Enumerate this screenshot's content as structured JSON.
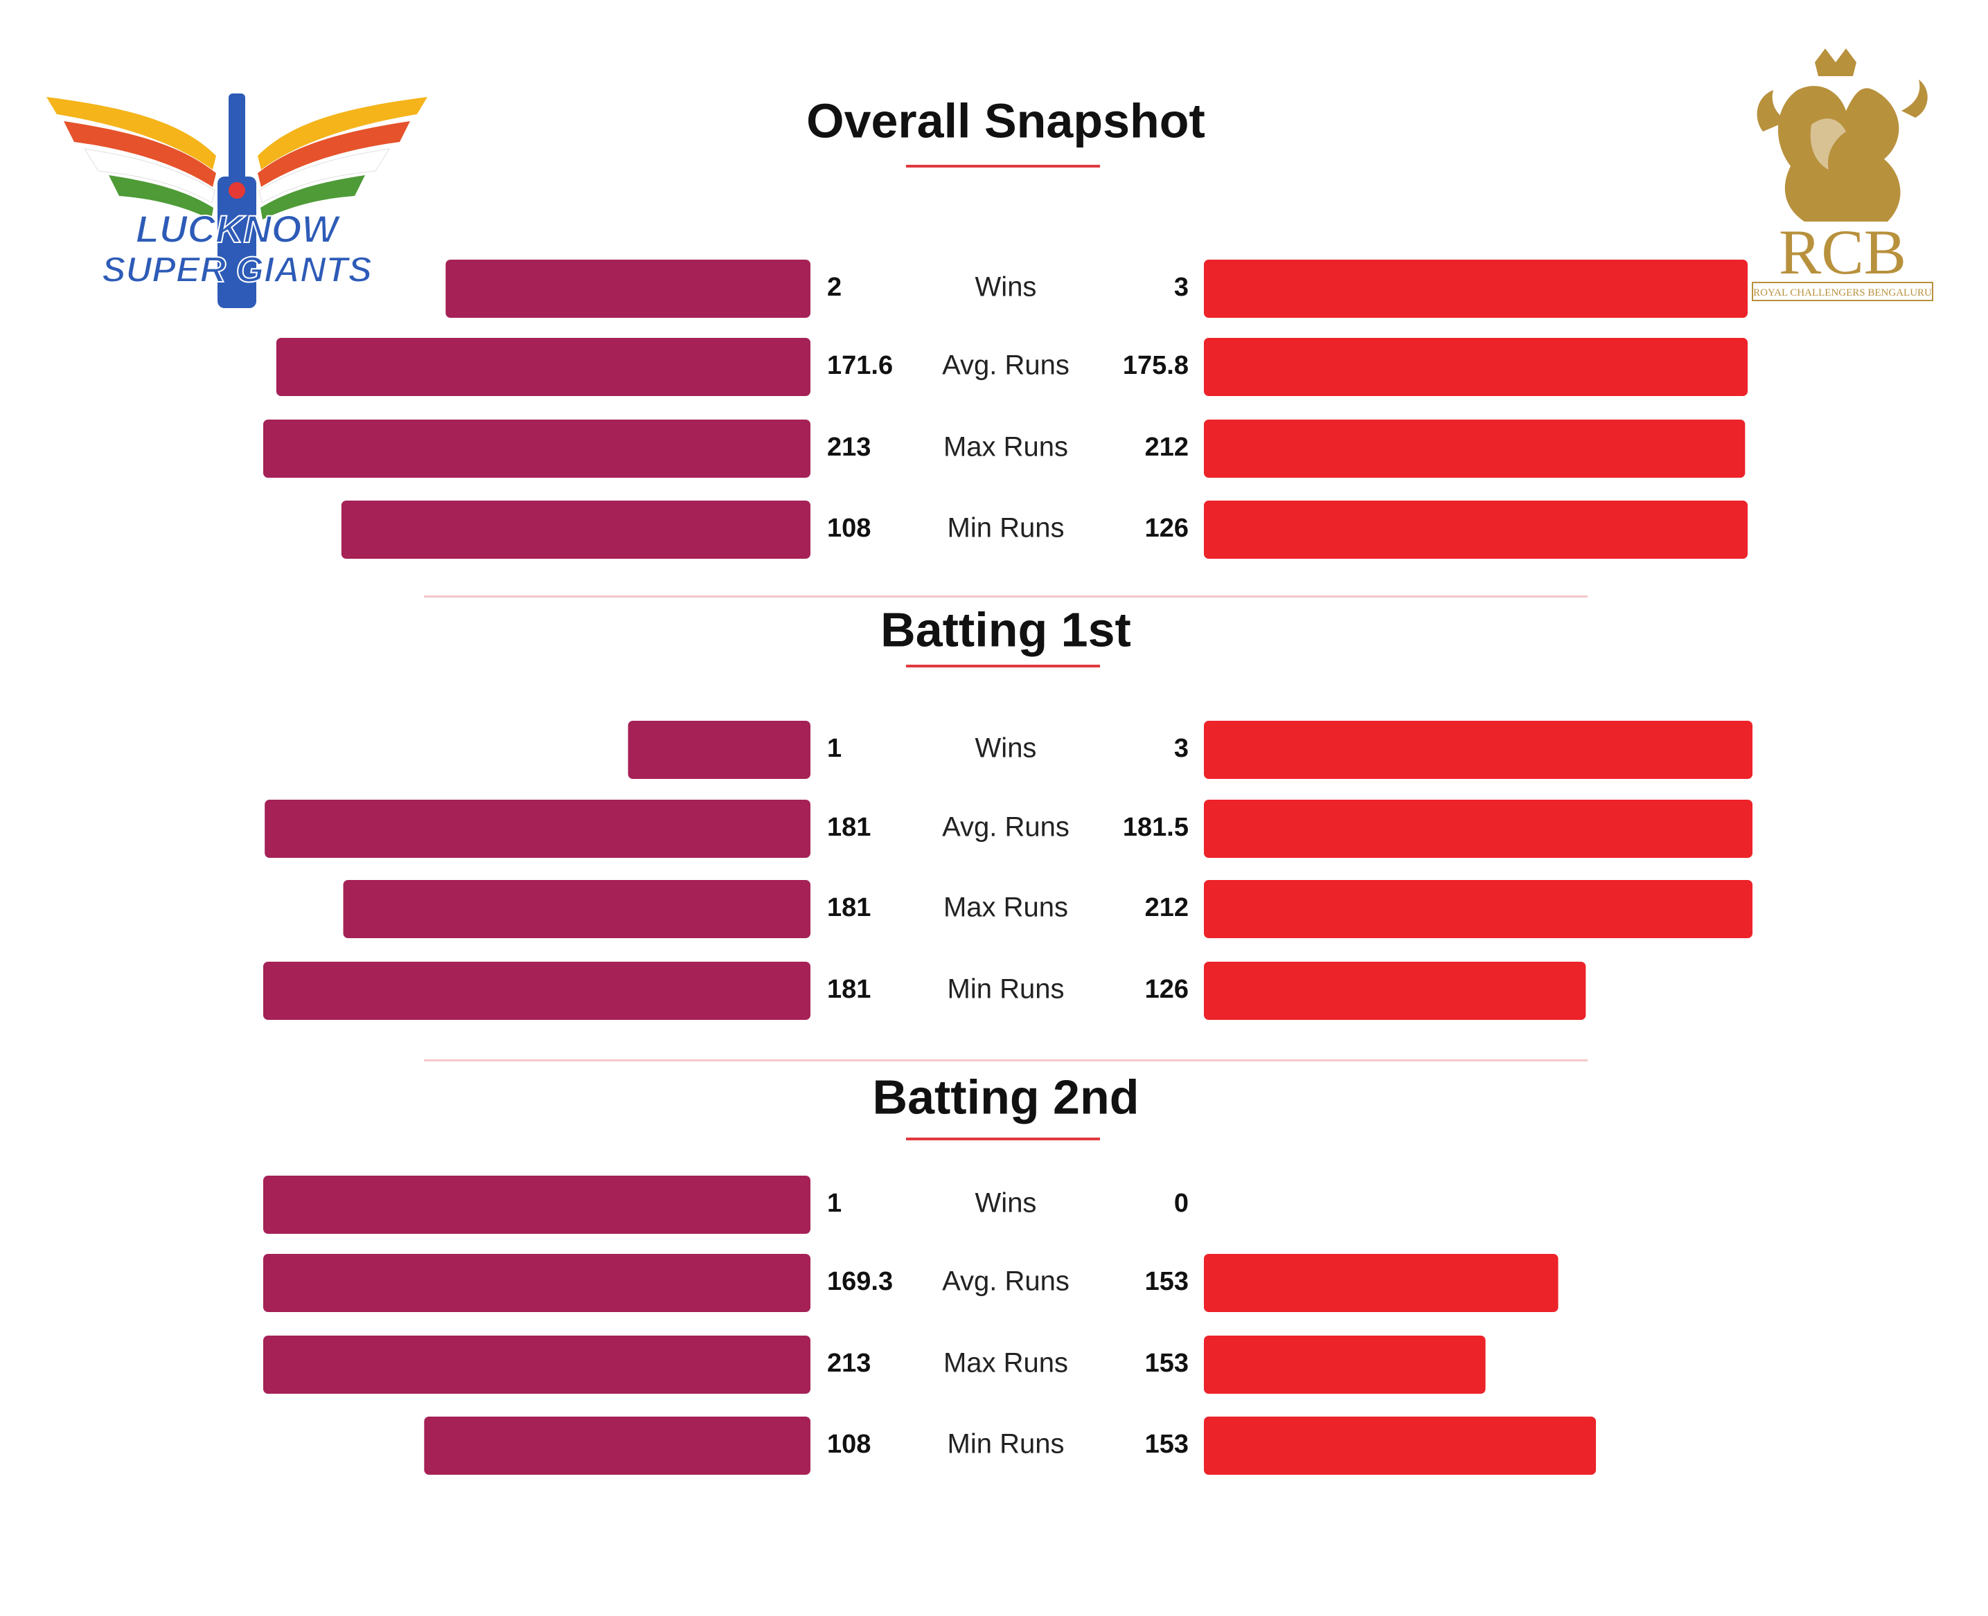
{
  "teams": {
    "left": {
      "name": "Lucknow Super Giants",
      "logo_text": [
        "LUCKNOW",
        "SUPER GIANTS"
      ],
      "color": "#A52156"
    },
    "right": {
      "name": "Royal Challengers Bengaluru",
      "logo_text": [
        "RCB",
        "ROYAL CHALLENGERS BENGALURU"
      ],
      "color": "#EC2329"
    }
  },
  "colors": {
    "divider": "#F4C6CB",
    "underline": "#E03A3E",
    "text": "#111111",
    "gold": "#B8913D"
  },
  "chart_data": [
    {
      "type": "bar",
      "title": "Overall Snapshot",
      "categories": [
        "Wins",
        "Avg. Runs",
        "Max Runs",
        "Min Runs"
      ],
      "series": [
        {
          "name": "Lucknow Super Giants",
          "labels": [
            "2",
            "171.6",
            "213",
            "108"
          ],
          "values": [
            2,
            171.6,
            213,
            108
          ]
        },
        {
          "name": "Royal Challengers Bengaluru",
          "labels": [
            "3",
            "175.8",
            "212",
            "126"
          ],
          "values": [
            3,
            175.8,
            212,
            126
          ]
        }
      ]
    },
    {
      "type": "bar",
      "title": "Batting 1st",
      "categories": [
        "Wins",
        "Avg. Runs",
        "Max Runs",
        "Min Runs"
      ],
      "series": [
        {
          "name": "Lucknow Super Giants",
          "labels": [
            "1",
            "181",
            "181",
            "181"
          ],
          "values": [
            1,
            181,
            181,
            181
          ]
        },
        {
          "name": "Royal Challengers Bengaluru",
          "labels": [
            "3",
            "181.5",
            "212",
            "126"
          ],
          "values": [
            3,
            181.5,
            212,
            126
          ]
        }
      ]
    },
    {
      "type": "bar",
      "title": "Batting 2nd",
      "categories": [
        "Wins",
        "Avg. Runs",
        "Max Runs",
        "Min Runs"
      ],
      "series": [
        {
          "name": "Lucknow Super Giants",
          "labels": [
            "1",
            "169.3",
            "213",
            "108"
          ],
          "values": [
            1,
            169.3,
            213,
            108
          ]
        },
        {
          "name": "Royal Challengers Bengaluru",
          "labels": [
            "0",
            "153",
            "153",
            "153"
          ],
          "values": [
            0,
            153,
            153,
            153
          ]
        }
      ]
    }
  ]
}
